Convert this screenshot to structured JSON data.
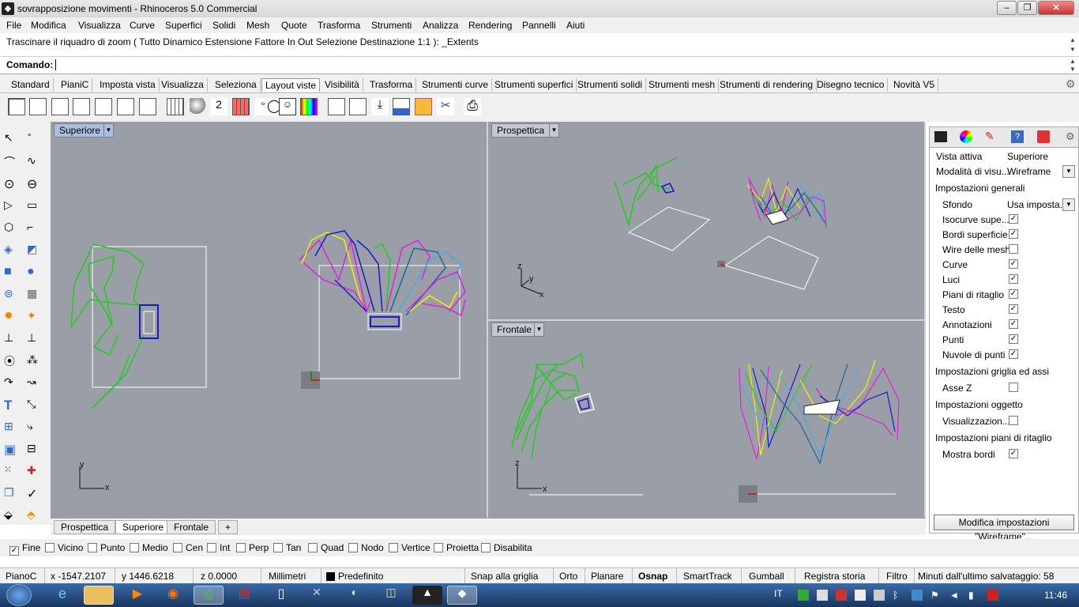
{
  "window": {
    "title": "sovrapposizione movimenti - Rhinoceros 5.0 Commercial",
    "min": "‒",
    "max": "❐",
    "close": "✕"
  },
  "menu": [
    "File",
    "Modifica",
    "Visualizza",
    "Curve",
    "Superfici",
    "Solidi",
    "Mesh",
    "Quote",
    "Trasforma",
    "Strumenti",
    "Analizza",
    "Rendering",
    "Pannelli",
    "Aiuti"
  ],
  "command": {
    "history": "Trascinare il riquadro di zoom ( Tutto  Dinamico  Estensione  Fattore  In  Out  Selezione  Destinazione  1:1 ): _Extents",
    "label": "Comando:",
    "value": ""
  },
  "toolbar_tabs": [
    "Standard",
    "PianiC",
    "Imposta vista",
    "Visualizza",
    "Seleziona",
    "Layout viste",
    "Visibilità",
    "Trasforma",
    "Strumenti curve",
    "Strumenti superfici",
    "Strumenti solidi",
    "Strumenti mesh",
    "Strumenti di rendering",
    "Disegno tecnico",
    "Novità V5"
  ],
  "active_toolbar_tab": "Layout viste",
  "viewports": {
    "top": {
      "title": "Superiore",
      "axis_x": "x",
      "axis_y": "y"
    },
    "persp": {
      "title": "Prospettica",
      "axis_x": "x",
      "axis_y": "y",
      "axis_z": "z"
    },
    "front": {
      "title": "Frontale",
      "axis_x": "x",
      "axis_z": "z"
    }
  },
  "viewport_tabs": [
    "Prospettica",
    "Superiore",
    "Frontale",
    "+"
  ],
  "active_viewport_tab": "Superiore",
  "panel": {
    "rows": [
      {
        "k": "Vista attiva",
        "v": "Superiore"
      },
      {
        "k": "Modalità di visu...",
        "v": "Wireframe",
        "select": true
      }
    ],
    "sec_general": "Impostazioni generali",
    "sfondo": {
      "k": "Sfondo",
      "v": "Usa imposta..."
    },
    "checks": [
      {
        "k": "Isocurve supe...",
        "checked": true
      },
      {
        "k": "Bordi superficie",
        "checked": true
      },
      {
        "k": "Wire delle mesh",
        "checked": false
      },
      {
        "k": "Curve",
        "checked": true
      },
      {
        "k": "Luci",
        "checked": true
      },
      {
        "k": "Piani di ritaglio",
        "checked": true
      },
      {
        "k": "Testo",
        "checked": true
      },
      {
        "k": "Annotazioni",
        "checked": true
      },
      {
        "k": "Punti",
        "checked": true
      },
      {
        "k": "Nuvole di punti",
        "checked": true
      }
    ],
    "sec_grid": "Impostazioni griglia ed assi",
    "asse_z": {
      "k": "Asse Z",
      "checked": false
    },
    "sec_obj": "Impostazioni oggetto",
    "visual": {
      "k": "Visualizzazion...",
      "checked": false
    },
    "sec_clip": "Impostazioni piani di ritaglio",
    "mostra": {
      "k": "Mostra bordi",
      "checked": true
    },
    "button": "Modifica impostazioni \"Wireframe\"..."
  },
  "osnap": [
    {
      "label": "Fine",
      "checked": true
    },
    {
      "label": "Vicino",
      "checked": false
    },
    {
      "label": "Punto",
      "checked": false
    },
    {
      "label": "Medio",
      "checked": false
    },
    {
      "label": "Cen",
      "checked": false
    },
    {
      "label": "Int",
      "checked": false
    },
    {
      "label": "Perp",
      "checked": false
    },
    {
      "label": "Tan",
      "checked": false
    },
    {
      "label": "Quad",
      "checked": false
    },
    {
      "label": "Nodo",
      "checked": false
    },
    {
      "label": "Vertice",
      "checked": false
    },
    {
      "label": "Proietta",
      "checked": false
    },
    {
      "label": "Disabilita",
      "checked": false
    }
  ],
  "status": {
    "plane": "PianoC",
    "x": "x -1547.2107",
    "y": "y 1446.6218",
    "z": "z 0.0000",
    "units": "Millimetri",
    "layer": "Predefinito",
    "buttons": [
      "Snap alla griglia",
      "Orto",
      "Planare",
      "Osnap",
      "SmartTrack",
      "Gumball",
      "Registra storia",
      "Filtro"
    ],
    "bold_button": "Osnap",
    "save": "Minuti dall'ultimo salvataggio: 58"
  },
  "taskbar": {
    "lang": "IT",
    "time": "11:46"
  },
  "colors": {
    "viewport_bg": "#9a9ea6",
    "curve_green": "#22cc22",
    "curve_blue": "#1a1acc",
    "curve_magenta": "#dd22dd",
    "curve_yellow": "#f5f000",
    "curve_cyan": "#44aaee",
    "plane_white": "#ffffff"
  }
}
